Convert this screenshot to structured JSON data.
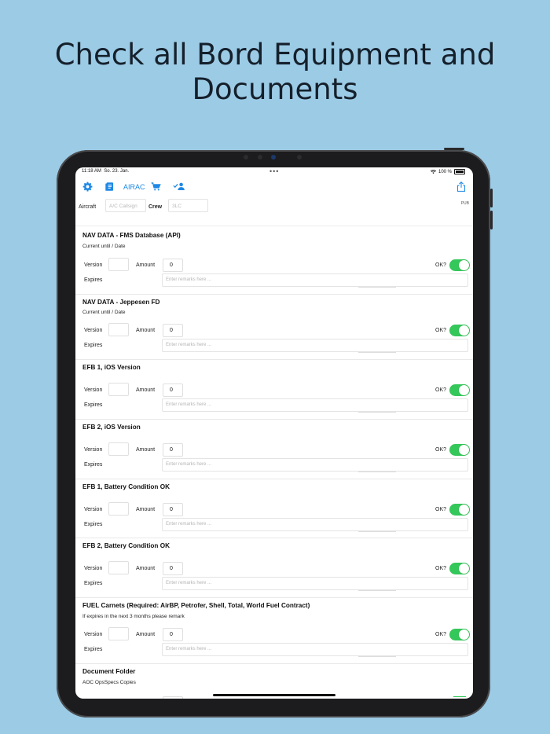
{
  "headline": {
    "line1": "Check all Bord Equipment and",
    "line2": "Documents"
  },
  "status_bar": {
    "time": "11:18 AM",
    "date": "So. 23. Jan.",
    "dots": "•••",
    "battery": "100 %"
  },
  "toolbar": {
    "airac_label": "AIRAC",
    "icons": [
      "gear-icon",
      "document-icon",
      "cart-icon",
      "check-person-icon",
      "share-icon"
    ]
  },
  "aircraft_row": {
    "aircraft_label": "Aircraft",
    "callsign_placeholder": "A/C Callsign",
    "crew_label": "Crew",
    "crew_placeholder": "3LC",
    "pub_label": "PUB"
  },
  "field_labels": {
    "version": "Version",
    "amount": "Amount",
    "expires": "Expires",
    "ok": "OK?",
    "remarks_placeholder": "Enter remarks here ..."
  },
  "sections": [
    {
      "title": "NAV DATA - FMS Database (API)",
      "subtitle": "Current until / Date",
      "amount": "0",
      "ok": true
    },
    {
      "title": "NAV DATA - Jeppesen FD",
      "subtitle": "Current until / Date",
      "amount": "0",
      "ok": true
    },
    {
      "title": "EFB 1, iOS Version",
      "subtitle": "",
      "amount": "0",
      "ok": true
    },
    {
      "title": "EFB 2, iOS Version",
      "subtitle": "",
      "amount": "0",
      "ok": true
    },
    {
      "title": "EFB 1, Battery Condition OK",
      "subtitle": "",
      "amount": "0",
      "ok": true
    },
    {
      "title": "EFB 2, Battery Condition OK",
      "subtitle": "",
      "amount": "0",
      "ok": true
    },
    {
      "title": "FUEL Carnets (Required: AirBP, Petrofer, Shell, Total, World Fuel Contract)",
      "subtitle": "If expires in the next 3 months please remark",
      "amount": "0",
      "ok": true
    },
    {
      "title": "Document Folder",
      "subtitle": "AOC OpsSpecs Copies",
      "amount": "",
      "ok": true
    }
  ],
  "colors": {
    "background": "#9ccbe6",
    "accent": "#1e88e5",
    "toggle_on": "#34c759"
  }
}
